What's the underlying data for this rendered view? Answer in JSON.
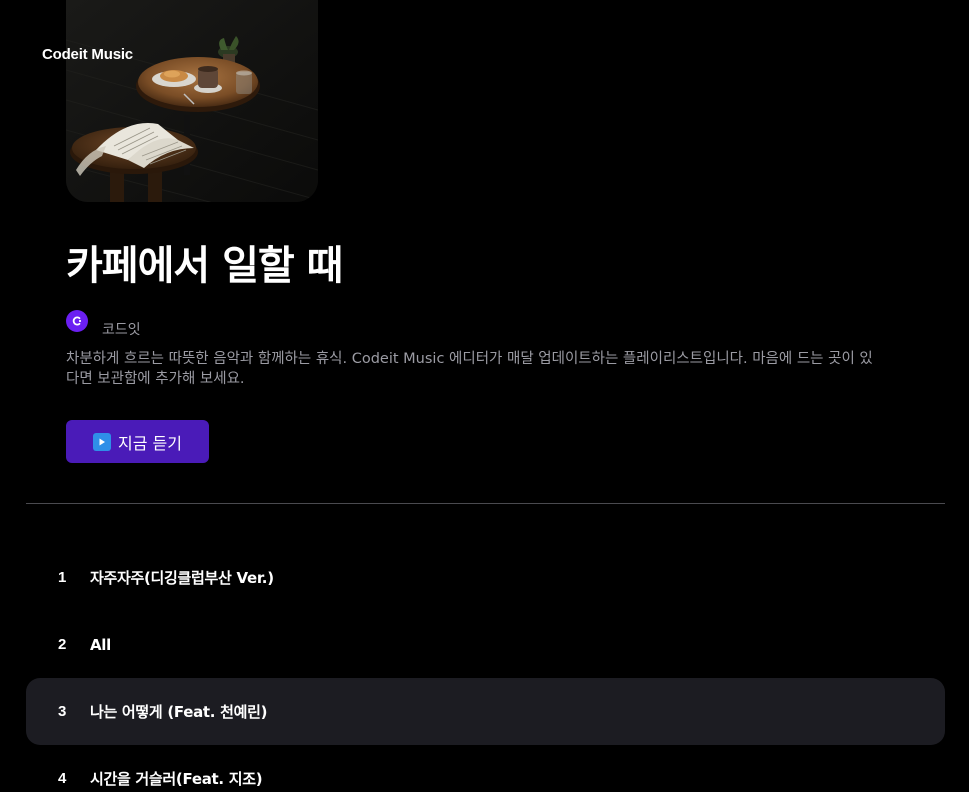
{
  "app": {
    "brand": "Codeit Music"
  },
  "playlist": {
    "title": "카페에서 일할 때",
    "curator": "코드잇",
    "description": "차분하게 흐르는 따뜻한 음악과 함께하는 휴식. Codeit Music 에디터가 매달 업데이트하는 플레이리스트입니다. 마음에 드는 곳이 있다면 보관함에 추가해 보세요.",
    "play_label": "지금 듣기",
    "cover_icon": "cafe-cover-image"
  },
  "tracks": [
    {
      "num": "1",
      "title": "자주자주(디깅클럽부산 Ver.)"
    },
    {
      "num": "2",
      "title": "All"
    },
    {
      "num": "3",
      "title": "나는 어떻게 (Feat. 천예린)"
    },
    {
      "num": "4",
      "title": "시간을 거슬러(Feat. 지조)"
    }
  ],
  "colors": {
    "background": "#000000",
    "accent": "#4a1bb8",
    "curator_avatar": "#6b1ff2",
    "active_row": "#1c1c22",
    "muted_text": "#9b9ba3"
  }
}
